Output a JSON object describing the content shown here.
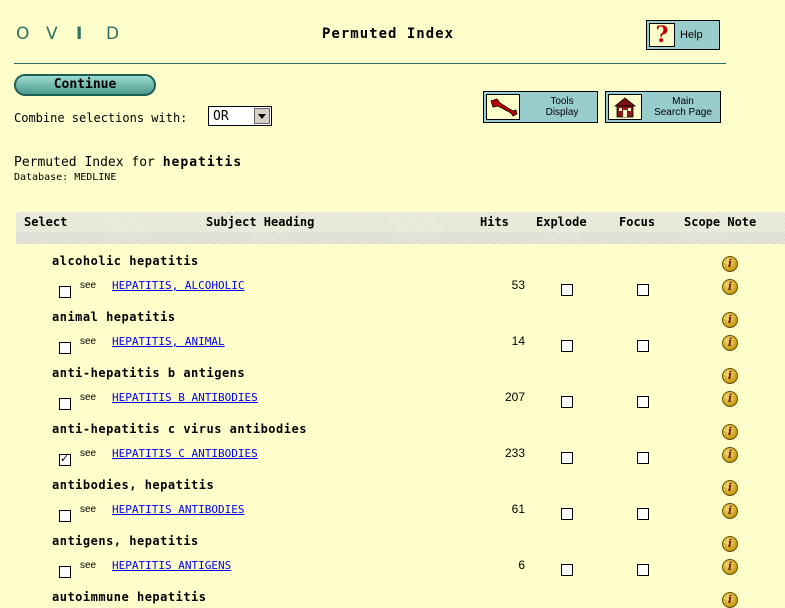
{
  "header": {
    "logo_letters": [
      "O",
      "V",
      "I",
      "D"
    ],
    "title": "Permuted Index",
    "help_label": "Help",
    "help_glyph": "?"
  },
  "toolbar": {
    "continue_label": "Continue",
    "combine_label": "Combine selections with:",
    "combine_value": "OR",
    "tools_label_1": "Tools",
    "tools_label_2": "Display",
    "main_label_1": "Main",
    "main_label_2": "Search Page"
  },
  "index": {
    "title_prefix": "Permuted Index for",
    "term": "hepatitis",
    "database": "Database: MEDLINE"
  },
  "table": {
    "columns": [
      "Select",
      "Subject Heading",
      "Hits",
      "Explode",
      "Focus",
      "Scope Note"
    ],
    "see_label": "see",
    "rows": [
      {
        "term": "alcoholic hepatitis",
        "heading": "HEPATITIS, ALCOHOLIC",
        "hits": "53",
        "selected": false
      },
      {
        "term": "animal hepatitis",
        "heading": "HEPATITIS, ANIMAL",
        "hits": "14",
        "selected": false
      },
      {
        "term": "anti-hepatitis b antigens",
        "heading": "HEPATITIS B ANTIBODIES",
        "hits": "207",
        "selected": false
      },
      {
        "term": "anti-hepatitis c virus antibodies",
        "heading": "HEPATITIS C ANTIBODIES",
        "hits": "233",
        "selected": true
      },
      {
        "term": "antibodies, hepatitis",
        "heading": "HEPATITIS ANTIBODIES",
        "hits": "61",
        "selected": false
      },
      {
        "term": "antigens, hepatitis",
        "heading": "HEPATITIS ANTIGENS",
        "hits": "6",
        "selected": false
      },
      {
        "term": "autoimmune hepatitis",
        "heading": "",
        "hits": "",
        "selected": false
      }
    ]
  },
  "colors": {
    "background": "#ffffcc",
    "accent": "#99cccc",
    "link": "#0000ee",
    "logo": "#2f6e62"
  },
  "icons": [
    "help-icon",
    "wrench-icon",
    "house-icon",
    "scope-note-info-icon",
    "dropdown-arrow-icon"
  ]
}
